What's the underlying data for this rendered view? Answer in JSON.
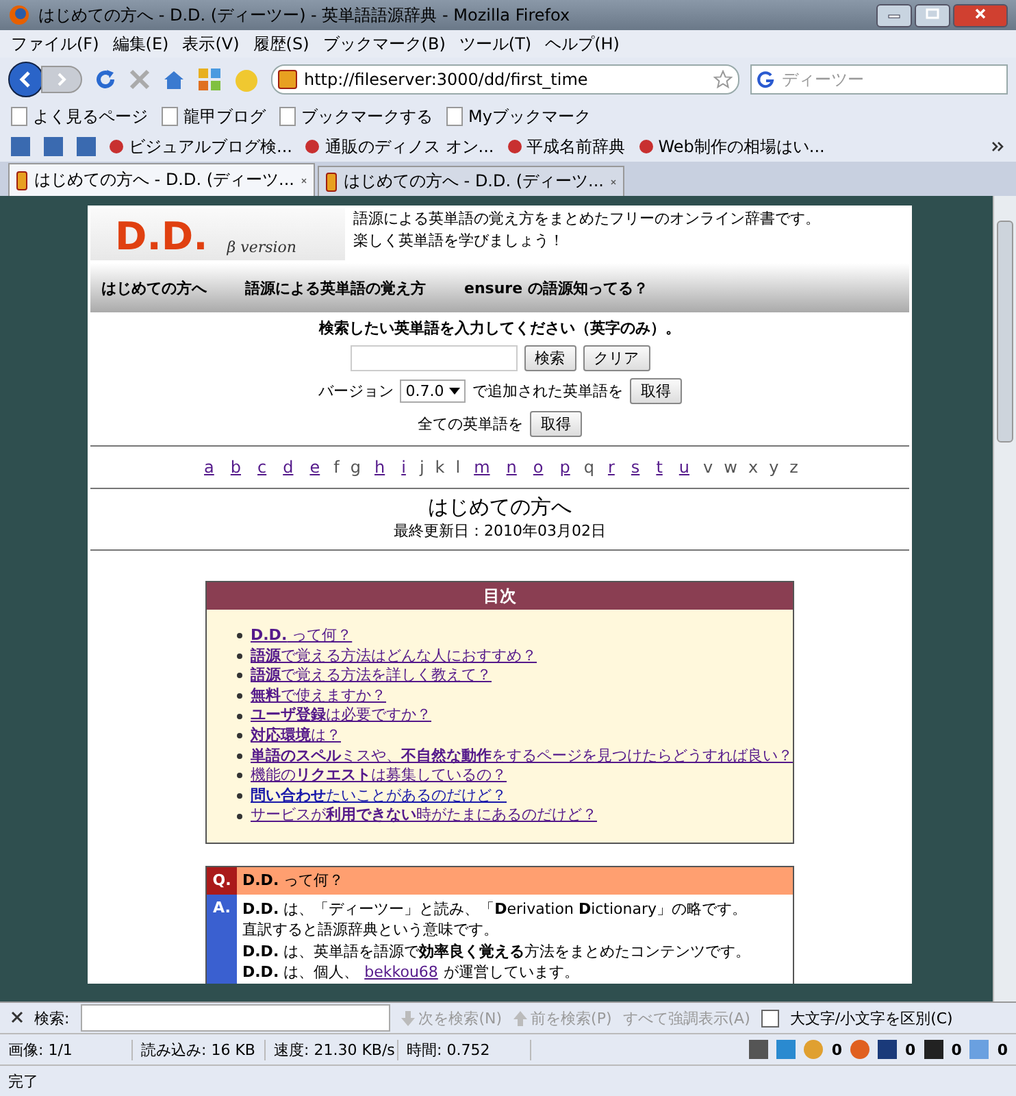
{
  "window": {
    "title": "はじめての方へ - D.D. (ディーツー) - 英単語語源辞典 - Mozilla Firefox"
  },
  "menu": [
    "ファイル(F)",
    "編集(E)",
    "表示(V)",
    "履歴(S)",
    "ブックマーク(B)",
    "ツール(T)",
    "ヘルプ(H)"
  ],
  "url": "http://fileserver:3000/dd/first_time",
  "search": {
    "value": "ディーツー"
  },
  "bookmarks": [
    "よく見るページ",
    "龍甲ブログ",
    "ブックマークする",
    "Myブックマーク"
  ],
  "bookmarks2": [
    "ビジュアルブログ検...",
    "通販のディノス オン...",
    "平成名前辞典",
    "Web制作の相場はい..."
  ],
  "tabs": [
    {
      "label": "はじめての方へ - D.D. (ディーツ...",
      "selected": true
    },
    {
      "label": "はじめての方へ - D.D. (ディーツ...",
      "selected": false
    }
  ],
  "page": {
    "logo": "D.D.",
    "logo_sub": "β version",
    "tagline": [
      "語源による英単語の覚え方をまとめたフリーのオンライン辞書です。",
      "楽しく英単語を学びましょう！"
    ],
    "nav": [
      "はじめての方へ",
      "語源による英単語の覚え方",
      "ensure の語源知ってる？"
    ],
    "search_prompt": "検索したい英単語を入力してください（英字のみ）。",
    "search_button": "検索",
    "clear_button": "クリア",
    "version_label": "バージョン",
    "version_value": "0.7.0",
    "version_suffix": "で追加された英単語を",
    "get_button": "取得",
    "all_label": "全ての英単語を",
    "all_button": "取得",
    "letters": [
      {
        "t": "a",
        "linked": true
      },
      {
        "t": "b",
        "linked": true
      },
      {
        "t": "c",
        "linked": true
      },
      {
        "t": "d",
        "linked": true
      },
      {
        "t": "e",
        "linked": true
      },
      {
        "t": "f",
        "linked": false
      },
      {
        "t": "g",
        "linked": false
      },
      {
        "t": "h",
        "linked": true
      },
      {
        "t": "i",
        "linked": true
      },
      {
        "t": "j",
        "linked": false
      },
      {
        "t": "k",
        "linked": false
      },
      {
        "t": "l",
        "linked": false
      },
      {
        "t": "m",
        "linked": true
      },
      {
        "t": "n",
        "linked": true
      },
      {
        "t": "o",
        "linked": true
      },
      {
        "t": "p",
        "linked": true
      },
      {
        "t": "q",
        "linked": false
      },
      {
        "t": "r",
        "linked": true
      },
      {
        "t": "s",
        "linked": true
      },
      {
        "t": "t",
        "linked": true
      },
      {
        "t": "u",
        "linked": true
      },
      {
        "t": "v",
        "linked": false
      },
      {
        "t": "w",
        "linked": false
      },
      {
        "t": "x",
        "linked": false
      },
      {
        "t": "y",
        "linked": false
      },
      {
        "t": "z",
        "linked": false
      }
    ],
    "heading": "はじめての方へ",
    "updated": "最終更新日：2010年03月02日",
    "toc_title": "目次",
    "toc": [
      {
        "text": "**D.D.** って何？",
        "visited": true
      },
      {
        "text": "**語源**で覚える方法はどんな人におすすめ？",
        "visited": true
      },
      {
        "text": "**語源**で覚える方法を詳しく教えて？",
        "visited": true
      },
      {
        "text": "**無料**で使えますか？",
        "visited": true
      },
      {
        "text": "**ユーザ登録**は必要ですか？",
        "visited": true
      },
      {
        "text": "**対応環境**は？",
        "visited": true
      },
      {
        "text": "**単語のスペル**ミスや、**不自然な動作**をするページを見つけたらどうすれば良い？",
        "visited": true
      },
      {
        "text": "機能の**リクエスト**は募集しているの？",
        "visited": true
      },
      {
        "text": "**問い合わせ**たいことがあるのだけど？",
        "visited": false
      },
      {
        "text": "サービスが**利用できない**時がたまにあるのだけど？",
        "visited": true
      }
    ],
    "q_mark": "Q.",
    "question": "**D.D.** って何？",
    "a_mark": "A.",
    "answer": [
      "**D.D.** は、「ディーツー」と読み、「**D**erivation **D**ictionary」の略です。",
      "直訳すると語源辞典という意味です。",
      "**D.D.** は、英単語を語源で**効率良く覚える**方法をまとめたコンテンツです。"
    ],
    "answer_last": {
      "before": "**D.D.** は、個人、",
      "link": "bekkou68",
      "after": "が運営しています。"
    }
  },
  "find_bar": {
    "label": "検索:",
    "next": "次を検索(N)",
    "prev": "前を検索(P)",
    "highlight": "すべて強調表示(A)",
    "match_case": "大文字/小文字を区別(C)",
    "match_case_checked": false
  },
  "status": [
    "画像: 1/1",
    "読み込み: 16 KB",
    "速度: 21.30 KB/s",
    "時間: 0.752"
  ],
  "status_counts": [
    "0",
    "0",
    "0",
    "0"
  ],
  "done": "完了"
}
